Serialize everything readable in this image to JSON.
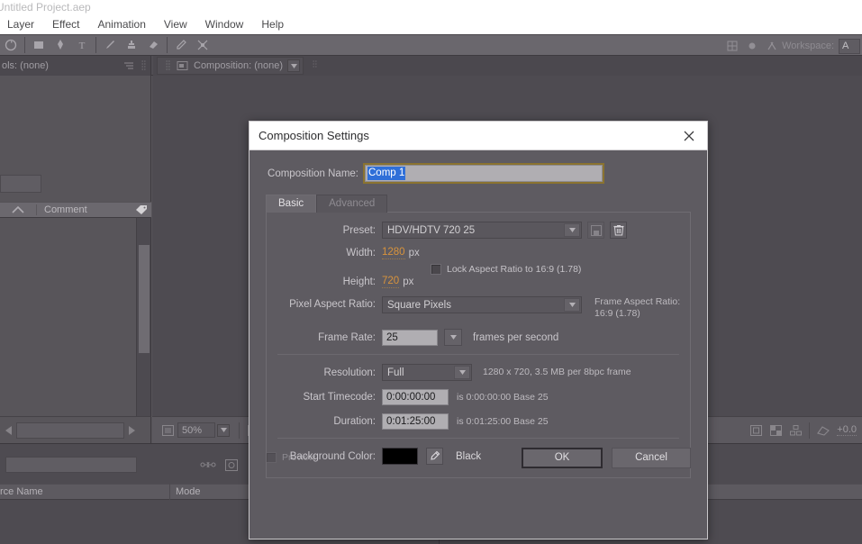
{
  "window": {
    "title": "Untitled Project.aep",
    "menus": [
      "Layer",
      "Effect",
      "Animation",
      "View",
      "Window",
      "Help"
    ],
    "workspace_label": "Workspace:",
    "workspace_value": "A"
  },
  "toolbar": {
    "tools": [
      {
        "name": "rotation-tool"
      },
      {
        "name": "shape-tool"
      },
      {
        "name": "pen-tool"
      },
      {
        "name": "text-tool"
      },
      {
        "name": "brush-tool"
      },
      {
        "name": "clone-stamp-tool"
      },
      {
        "name": "eraser-tool"
      },
      {
        "name": "roto-brush-tool"
      },
      {
        "name": "puppet-pin-tool"
      }
    ]
  },
  "panels": {
    "effect_controls_tab": "ols: (none)",
    "composition_tab": "Composition: (none)",
    "comment_column": "Comment",
    "zoom_value": "50%",
    "comp_offset_value": "+0.0"
  },
  "timeline": {
    "columns": [
      "rce Name",
      "Mode"
    ]
  },
  "dialog": {
    "title": "Composition Settings",
    "close_label": "✕",
    "composition_name_label": "Composition Name:",
    "composition_name_value": "Comp 1",
    "tabs": [
      {
        "label": "Basic",
        "active": true
      },
      {
        "label": "Advanced",
        "active": false
      }
    ],
    "preset_label": "Preset:",
    "preset_value": "HDV/HDTV 720 25",
    "width_label": "Width:",
    "width_value": "1280",
    "width_unit": "px",
    "height_label": "Height:",
    "height_value": "720",
    "height_unit": "px",
    "lock_aspect_label": "Lock Aspect Ratio to 16:9 (1.78)",
    "lock_aspect_checked": false,
    "pixel_aspect_label": "Pixel Aspect Ratio:",
    "pixel_aspect_value": "Square Pixels",
    "frame_aspect_title": "Frame Aspect Ratio:",
    "frame_aspect_value": "16:9 (1.78)",
    "frame_rate_label": "Frame Rate:",
    "frame_rate_value": "25",
    "frame_rate_unit": "frames per second",
    "resolution_label": "Resolution:",
    "resolution_value": "Full",
    "resolution_note": "1280 x 720, 3.5 MB per 8bpc frame",
    "start_timecode_label": "Start Timecode:",
    "start_timecode_value": "0:00:00:00",
    "start_timecode_note": "is 0:00:00:00  Base 25",
    "duration_label": "Duration:",
    "duration_value": "0:01:25:00",
    "duration_note": "is 0:01:25:00  Base 25",
    "background_color_label": "Background Color:",
    "background_color_hex": "#000000",
    "background_color_name": "Black",
    "preview_label": "Preview",
    "preview_checked": false,
    "ok_label": "OK",
    "cancel_label": "Cancel"
  },
  "colors": {
    "accent_orange": "#d8933c",
    "selection_blue": "#2f6fd8",
    "panel_bg": "#5e5b61",
    "app_bg": "#58555a"
  }
}
